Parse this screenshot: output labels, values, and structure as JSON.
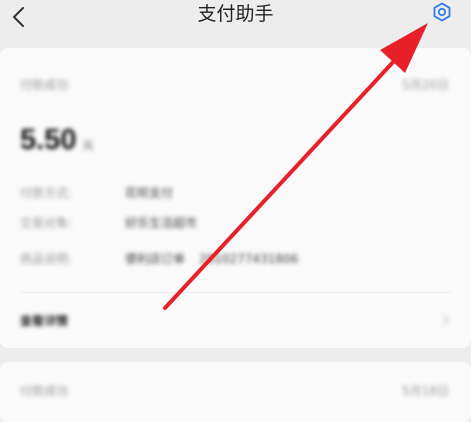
{
  "header": {
    "title": "支付助手",
    "back_icon": "chevron-left-icon",
    "settings_icon": "gear-icon"
  },
  "payment_card": {
    "status": "付款成功",
    "date": "5月20日",
    "amount": "5.50",
    "unit": "元",
    "details": [
      {
        "label": "付款方式:",
        "value": "花呗支付",
        "extra": ""
      },
      {
        "label": "交易对象:",
        "value": "好乐生活超市",
        "extra": ""
      },
      {
        "label": "商品说明:",
        "value": "便利店订单",
        "extra": "2810277431806"
      }
    ],
    "view_details": "查看详情"
  },
  "second_card": {
    "status": "付款成功",
    "date": "5月18日"
  },
  "colors": {
    "accent": "#2f7de1",
    "arrow": "#e8202a",
    "background": "#eeeded",
    "card": "#fafafa"
  }
}
